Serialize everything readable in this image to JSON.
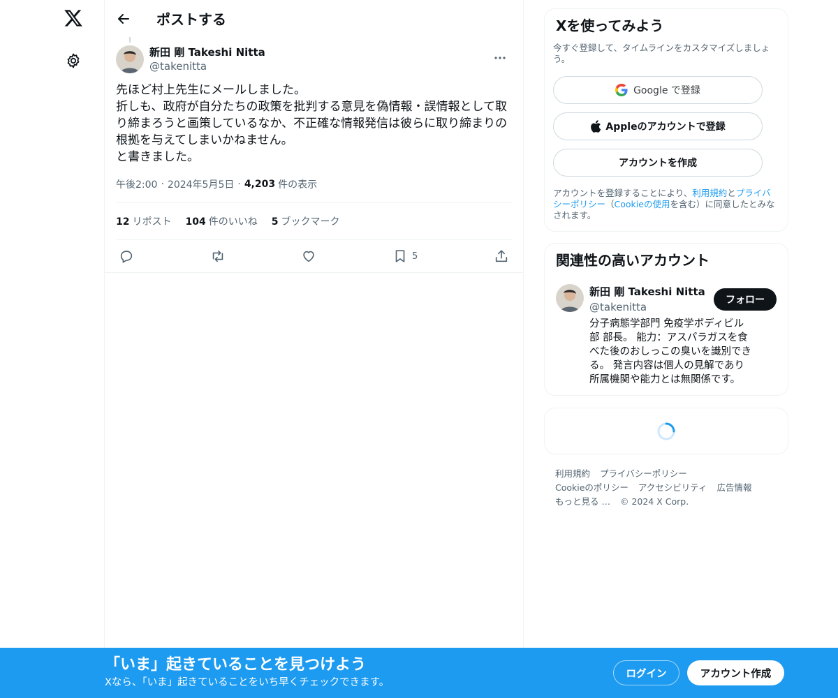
{
  "header": {
    "title": "ポストする"
  },
  "post": {
    "author_name": "新田 剛 Takeshi Nitta",
    "author_handle": "@takenitta",
    "body_lines": [
      "先ほど村上先生にメールしました。",
      "折しも、政府が自分たちの政策を批判する意見を偽情報・誤情報として取",
      "り締まろうと画策しているなか、不正確な情報発信は彼らに取り締まりの",
      "根拠を与えてしまいかねません。",
      "と書きました。"
    ],
    "time": "午後2:00",
    "date": "2024年5月5日",
    "views_count": "4,203",
    "views_label": "件の表示",
    "reposts_count": "12",
    "reposts_label": "リポスト",
    "likes_count": "104",
    "likes_label": "件のいいね",
    "bookmarks_count": "5",
    "bookmarks_label": "ブックマーク",
    "bookmark_action_count": "5"
  },
  "signup": {
    "title": "Xを使ってみよう",
    "subtitle": "今すぐ登録して、タイムラインをカスタマイズしましょう。",
    "google_label": "Google で登録",
    "apple_label": "Appleのアカウントで登録",
    "create_label": "アカウントを作成",
    "legal_prefix": "アカウントを登録することにより、",
    "legal_terms": "利用規約",
    "legal_and": "と",
    "legal_privacy": "プライバシーポリシー",
    "legal_open": "（",
    "legal_cookie": "Cookieの使用",
    "legal_suffix": "を含む）に同意したとみなされます。"
  },
  "related": {
    "title": "関連性の高いアカウント",
    "name": "新田 剛 Takeshi Nitta",
    "handle": "@takenitta",
    "follow_label": "フォロー",
    "bio": "分子病態学部門 免疫学ボディビル部 部長。 能力：アスパラガスを食べた後のおしっこの臭いを識別できる。 発言内容は個人の見解であり所属機関や能力とは無関係です。"
  },
  "footer": {
    "terms": "利用規約",
    "privacy": "プライバシーポリシー",
    "cookie": "Cookieのポリシー",
    "accessibility": "アクセシビリティ",
    "ads": "広告情報",
    "more": "もっと見る …",
    "copyright": "© 2024 X Corp."
  },
  "banner": {
    "title": "「いま」起きていることを見つけよう",
    "subtitle": "Xなら、「いま」起きていることをいち早くチェックできます。",
    "login_label": "ログイン",
    "create_label": "アカウント作成"
  },
  "colors": {
    "accent": "#1d9bf0",
    "text": "#0f1419",
    "muted": "#536471",
    "border": "#eff3f4"
  },
  "icons": [
    "x-logo-icon",
    "gear-icon",
    "back-arrow-icon",
    "more-icon",
    "reply-icon",
    "repost-icon",
    "like-icon",
    "bookmark-icon",
    "share-icon",
    "google-icon",
    "apple-icon",
    "loading-spinner-icon"
  ]
}
